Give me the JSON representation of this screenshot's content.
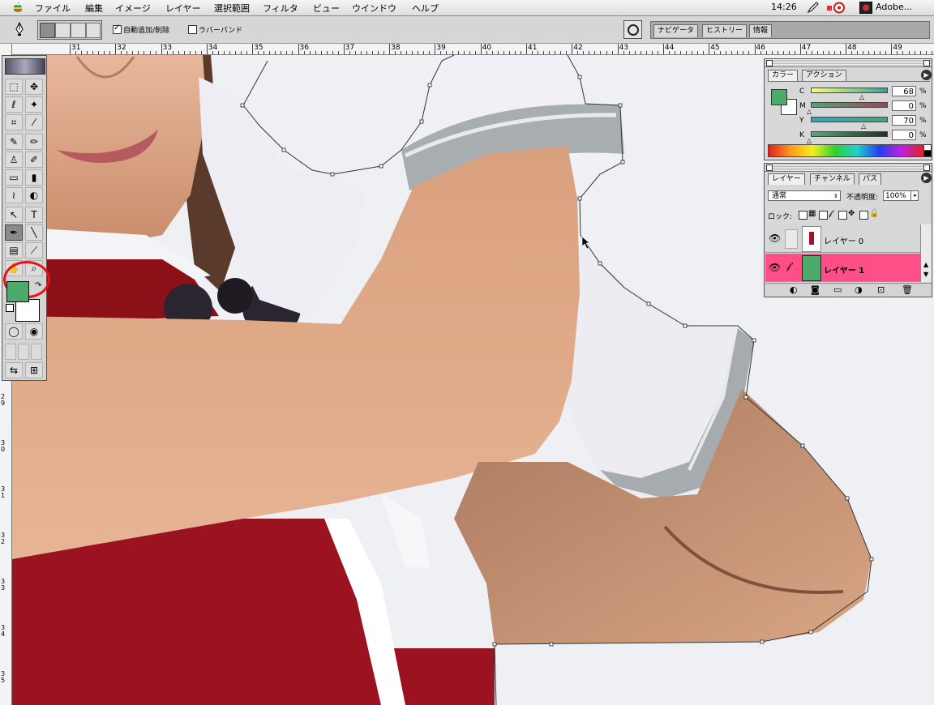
{
  "menubar": {
    "items": [
      "ファイル",
      "編集",
      "イメージ",
      "レイヤー",
      "選択範囲",
      "フィルタ",
      "ビュー",
      "ウインドウ",
      "ヘルプ"
    ],
    "clock": "14:26",
    "app_name": "Adobe..."
  },
  "options_bar": {
    "auto_add_delete_label": "自動追加/削除",
    "auto_add_delete_checked": true,
    "rubber_band_label": "ラバーバンド",
    "rubber_band_checked": false,
    "palette_well_tabs": [
      "ナビゲータ",
      "ヒストリー",
      "情報"
    ]
  },
  "rulers": {
    "horizontal_labels": [
      "31",
      "32",
      "33",
      "34",
      "35",
      "36",
      "37",
      "38",
      "39",
      "40",
      "41",
      "42",
      "43",
      "44",
      "45",
      "46",
      "47",
      "48",
      "49"
    ],
    "vertical_labels": [
      "2\n9",
      "3\n0",
      "3\n1",
      "3\n2",
      "3\n3",
      "3\n4",
      "3\n5"
    ]
  },
  "toolbox": {
    "selected_tool": "pen-tool",
    "highlighted_tool": "pen-tool",
    "foreground_color": "#4caa6b",
    "background_color": "#ffffff"
  },
  "color_palette": {
    "tabs": [
      "カラー",
      "アクション"
    ],
    "active_tab": "カラー",
    "channels": [
      {
        "label": "C",
        "value": "68",
        "unit": "%"
      },
      {
        "label": "M",
        "value": "0",
        "unit": "%"
      },
      {
        "label": "Y",
        "value": "70",
        "unit": "%"
      },
      {
        "label": "K",
        "value": "0",
        "unit": "%"
      }
    ]
  },
  "layers_palette": {
    "tabs": [
      "レイヤー",
      "チャンネル",
      "パス"
    ],
    "active_tab": "レイヤー",
    "blend_mode": "通常",
    "opacity_label": "不透明度:",
    "opacity_value": "100%",
    "lock_label": "ロック:",
    "layers": [
      {
        "name": "レイヤー 0",
        "selected": false,
        "visible": true
      },
      {
        "name": "レイヤー 1",
        "selected": true,
        "visible": true
      }
    ],
    "selected_color": "#ff4f86"
  }
}
